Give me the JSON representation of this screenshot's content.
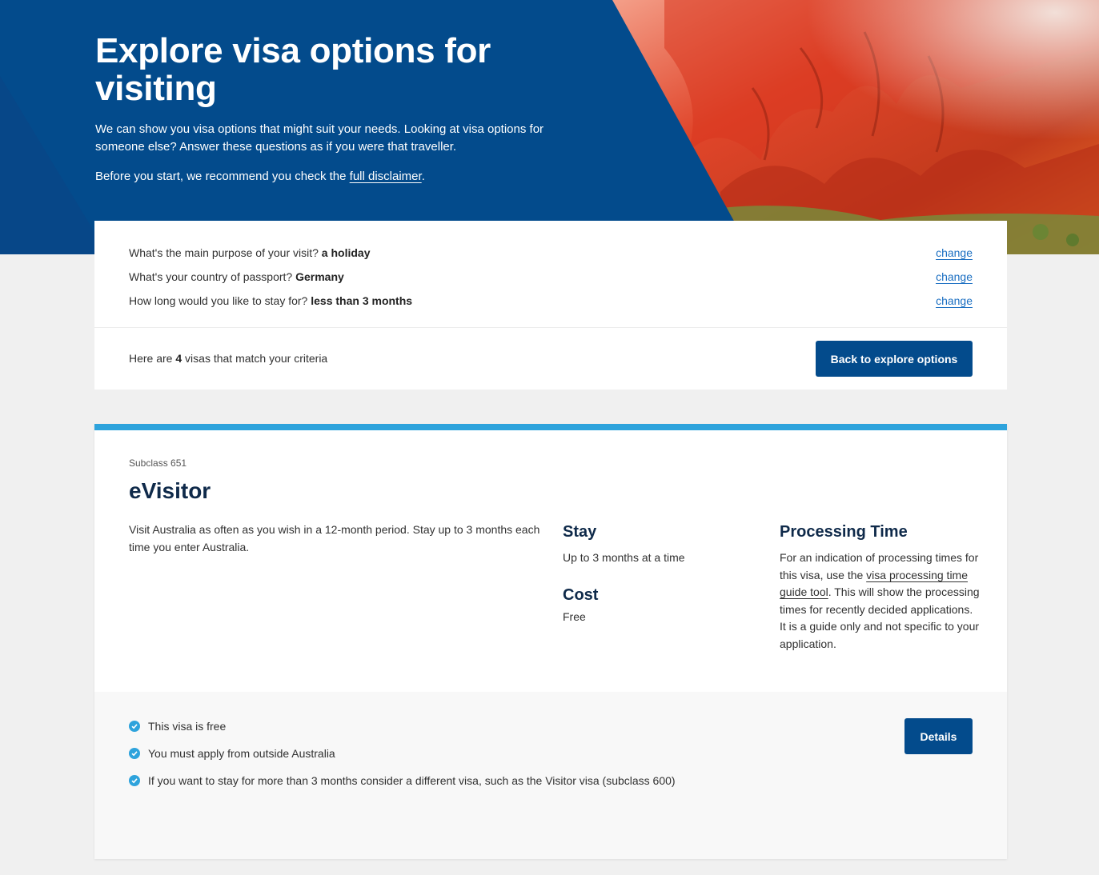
{
  "hero": {
    "title": "Explore visa options for visiting",
    "intro": "We can show you visa options that might suit your needs. Looking at visa options for someone else? Answer these questions as if you were that traveller.",
    "disclaimer_prefix": "Before you start, we recommend you check the ",
    "disclaimer_link": "full disclaimer",
    "disclaimer_suffix": "."
  },
  "criteria": {
    "rows": [
      {
        "question": "What's the main purpose of your visit? ",
        "answer": "a holiday",
        "link": "change"
      },
      {
        "question": "What's your country of passport? ",
        "answer": "Germany",
        "link": "change"
      },
      {
        "question": "How long would you like to stay for? ",
        "answer": "less than 3 months",
        "link": "change"
      }
    ],
    "match_prefix": "Here are ",
    "match_count": "4",
    "match_suffix": " visas that match your criteria",
    "back_button": "Back to explore options"
  },
  "visa": {
    "subclass": "Subclass 651",
    "name": "eVisitor",
    "description": "Visit Australia as often as you wish in a 12-month period. Stay up to 3 months each time you enter Australia.",
    "stay_heading": "Stay",
    "stay_text": "Up to 3 months at a time",
    "cost_heading": "Cost",
    "cost_text": "Free",
    "processing_heading": "Processing Time",
    "processing_prefix": "For an indication of processing times for this visa, use the ",
    "processing_link": "visa processing time guide tool",
    "processing_suffix": ". This will show the processing times for recently decided applications. It is a guide only and not specific to your application.",
    "bullets": [
      "This visa is free",
      "You must apply from outside Australia",
      "If you want to stay for more than 3 months consider a different visa, such as the Visitor visa (subclass 600)"
    ],
    "details_button": "Details"
  },
  "colors": {
    "brand_blue": "#034b8c",
    "accent_blue": "#2ea3dc",
    "link_blue": "#1b6fc2"
  }
}
